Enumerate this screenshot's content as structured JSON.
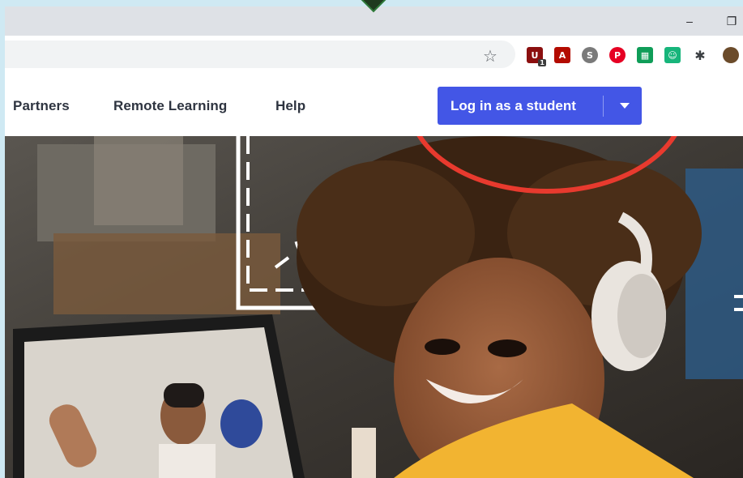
{
  "window": {
    "minimize_glyph": "–",
    "restore_glyph": "❐"
  },
  "toolbar": {
    "bookmark_glyph": "☆",
    "extensions": [
      {
        "icon": "ublock-icon",
        "color": "#8b0f0f",
        "glyph": "U",
        "badge": "1"
      },
      {
        "icon": "adobe-acrobat-icon",
        "color": "#b30b00",
        "glyph": "A"
      },
      {
        "icon": "skype-icon",
        "color": "#7a7a7a",
        "glyph": "S"
      },
      {
        "icon": "pinterest-icon",
        "color": "#e60023",
        "glyph": "P"
      },
      {
        "icon": "sheets-icon",
        "color": "#0f9d58",
        "glyph": "▦"
      },
      {
        "icon": "grammar-icon",
        "color": "#17b57b",
        "glyph": "☺"
      },
      {
        "icon": "puzzle-icon",
        "color": "#5f6368",
        "glyph": "✱"
      }
    ]
  },
  "nav": {
    "links": [
      "Partners",
      "Remote Learning",
      "Help"
    ],
    "login_label": "Log in as a student"
  },
  "colors": {
    "login_button": "#4356e6",
    "highlight_ring": "#e83a2e"
  }
}
